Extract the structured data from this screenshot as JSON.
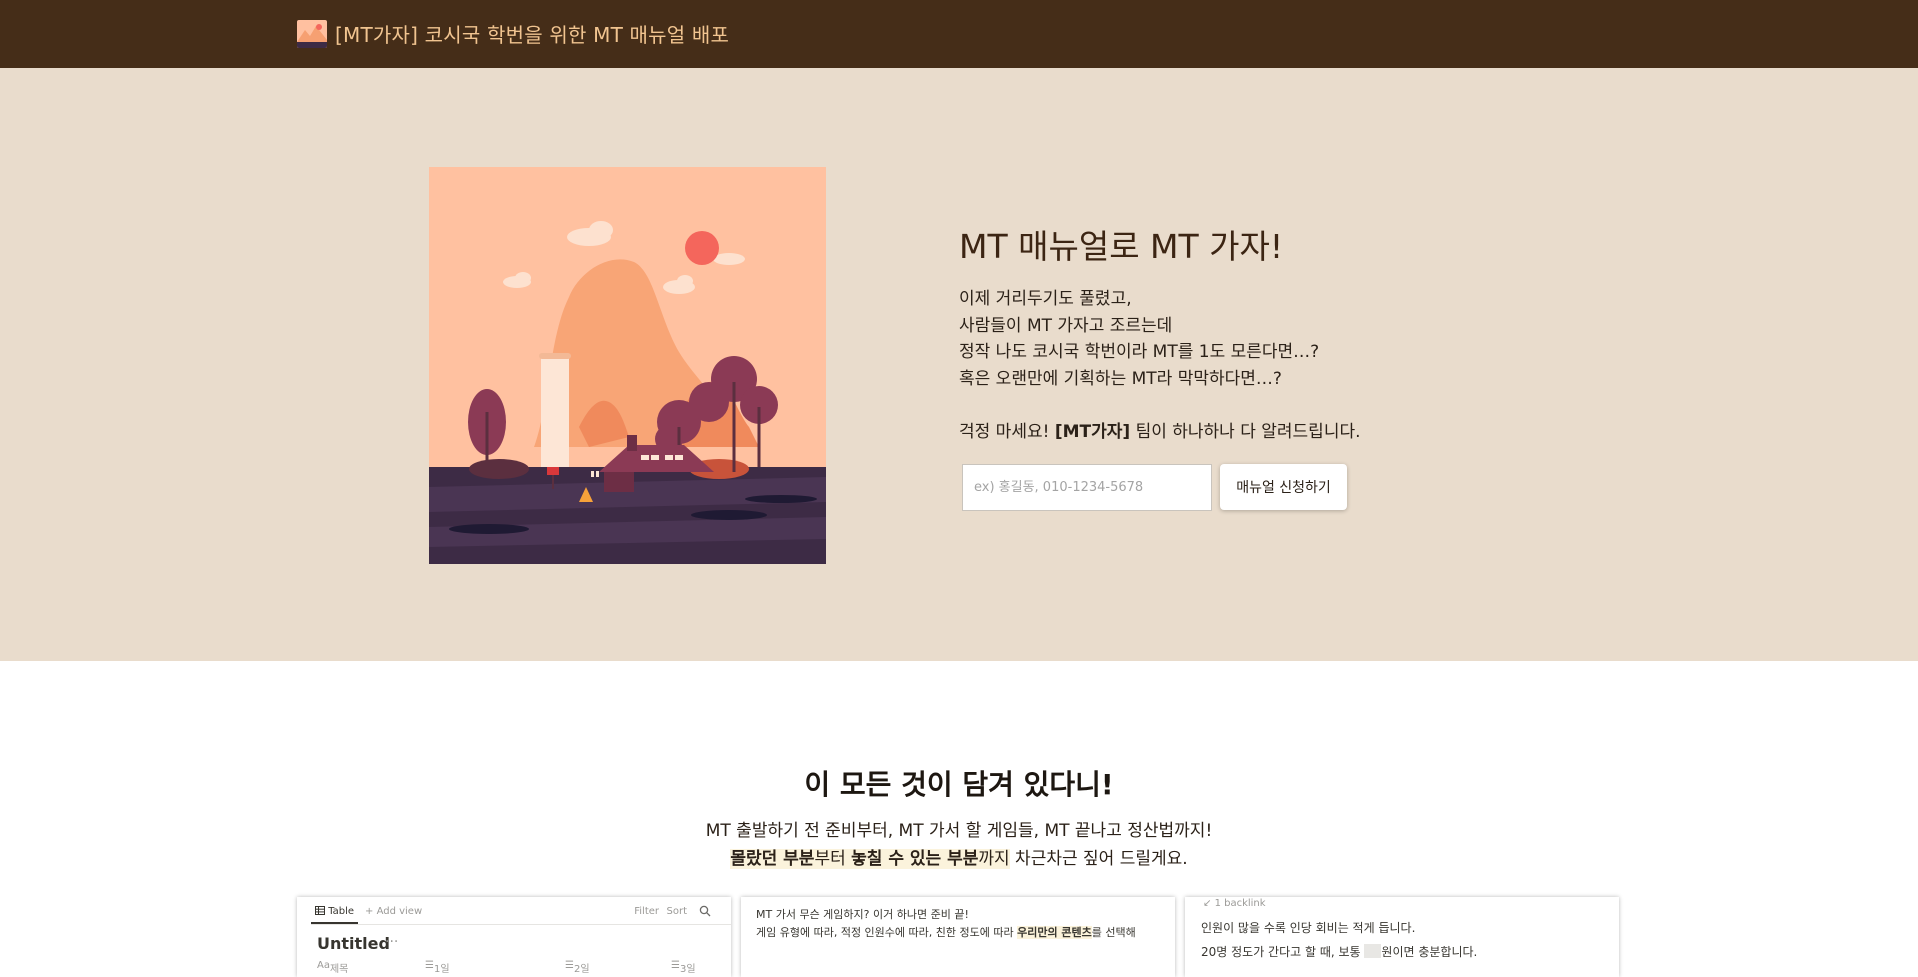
{
  "header": {
    "logo_icon": "landscape-logo-icon",
    "title": "[MT가자] 코시국 학번을 위한 MT 매뉴얼 배포",
    "bg_color": "#452d18",
    "title_color": "#f1c490"
  },
  "hero": {
    "illustration_icon": "mountain-landscape-illustration",
    "title": "MT 매뉴얼로 MT 가자!",
    "lines": [
      "이제 거리두기도 풀렸고,",
      "사람들이 MT 가자고 조르는데",
      "정작 나도 코시국 학번이라 MT를 1도 모른다면…?",
      "혹은 오랜만에 기획하는 MT라 막막하다면…?"
    ],
    "closing": {
      "pre": "걱정 마세요! ",
      "bold": "[MT가자]",
      "post": " 팀이 하나하나 다 알려드립니다."
    },
    "phone_placeholder": "ex) 홍길동, 010-1234-5678",
    "apply_label": "매뉴얼 신청하기",
    "bg_color": "#e9dccc"
  },
  "features": {
    "heading": "이 모든 것이 담겨 있다니!",
    "line1": "MT 출발하기 전 준비부터, MT 가서 할 게임들, MT 끝나고 정산법까지!",
    "line2": {
      "b1": "몰랐던 부분",
      "t1": "부터 ",
      "b2": "놓칠 수 있는 부분",
      "t2": "까지",
      "t3": " 차근차근 짚어 드릴게요."
    }
  },
  "cards": {
    "table": {
      "tab_label": "Table",
      "add_view": "Add view",
      "filter": "Filter",
      "sort": "Sort",
      "title": "Untitled",
      "more": "···",
      "columns": [
        "제목",
        "1일",
        "2일",
        "3일"
      ]
    },
    "games": {
      "line1": "MT 가서 무슨 게임하지? 이거 하나면 준비 끝!",
      "line2_pre": "게임 유형에 따라, 적정 인원수에 따라, 친한 정도에 따라 ",
      "line2_highlight": "우리만의 콘텐츠",
      "line2_post": "를 선택해"
    },
    "cost": {
      "backlink": "1 backlink",
      "line1": "인원이 많을 수록 인당 회비는 적게 듭니다.",
      "line2_pre": "20명 정도가 간다고 할 때, 보통 ",
      "line2_post": "원이면 충분합니다."
    }
  }
}
